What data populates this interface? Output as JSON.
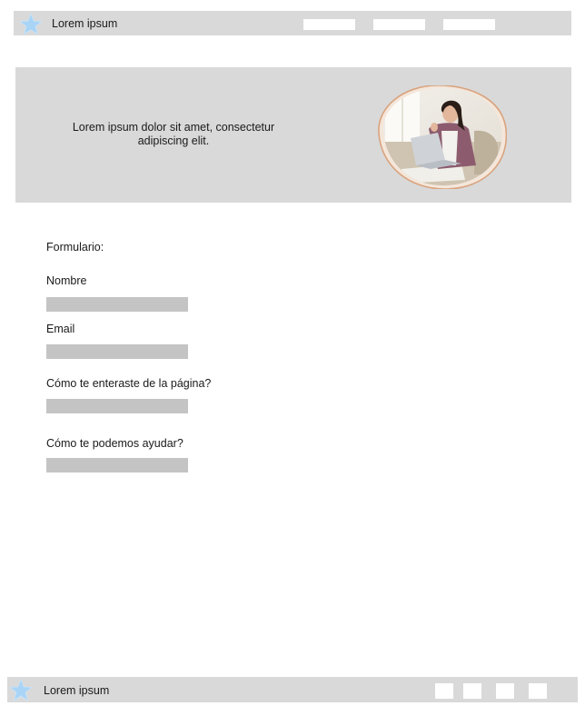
{
  "header": {
    "brand": "Lorem ipsum",
    "logo_icon": "star-icon",
    "nav_items": [
      "",
      "",
      ""
    ]
  },
  "hero": {
    "text": "Lorem ipsum dolor sit amet, consectetur adipiscing elit.",
    "image": "woman-with-laptop-photo"
  },
  "form": {
    "title": "Formulario:",
    "fields": [
      {
        "label": "Nombre",
        "value": ""
      },
      {
        "label": "Email",
        "value": ""
      },
      {
        "label": "Cómo te enteraste de la página?",
        "value": ""
      },
      {
        "label": "Cómo te podemos ayudar?",
        "value": ""
      }
    ]
  },
  "footer": {
    "brand": "Lorem ipsum",
    "logo_icon": "star-icon",
    "links": [
      "",
      "",
      "",
      ""
    ]
  },
  "colors": {
    "panel_bg": "#d9d9d9",
    "input_bg": "#c4c4c4",
    "star_fill": "#a9d4f5",
    "frame_accent": "#d9a37e"
  }
}
